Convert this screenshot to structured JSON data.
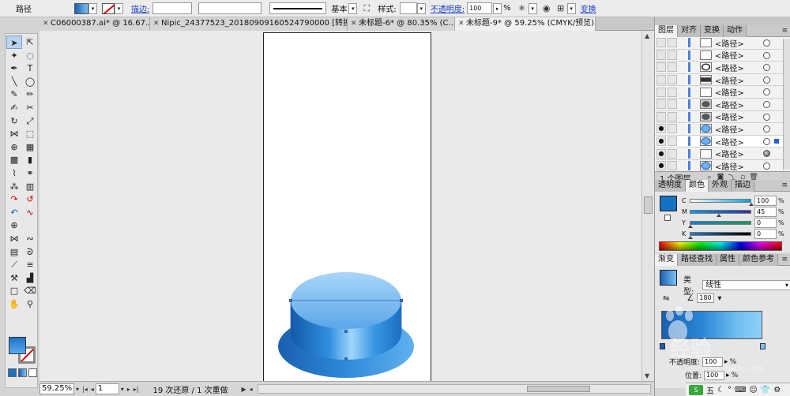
{
  "control_bar": {
    "object_label": "路径",
    "stroke_link": "描边:",
    "stroke_profile": "基本",
    "style_label": "样式:",
    "opacity_link": "不透明度:",
    "opacity_value": "100",
    "opacity_unit": "%",
    "transform_link": "变换"
  },
  "tabs": [
    {
      "label": "C06000387.ai* @ 16.67..."
    },
    {
      "label": "Nipic_24377523_20180909160524790000  [转换].ai*..."
    },
    {
      "label": "未标题-6* @ 80.35% (C..."
    },
    {
      "label": "未标题-9* @ 59.25% (CMYK/预览)"
    }
  ],
  "status_bar": {
    "zoom": "59.25%",
    "page": "1",
    "history": "19 次还原 / 1 次重做"
  },
  "layers_panel": {
    "tabs": [
      "图层",
      "对齐",
      "变换",
      "动作"
    ],
    "rows": [
      {
        "name": "<路径>",
        "visible": false,
        "thumb": "plain"
      },
      {
        "name": "<路径>",
        "visible": false,
        "thumb": "plain"
      },
      {
        "name": "<路径>",
        "visible": false,
        "thumb": "ring"
      },
      {
        "name": "<路径>",
        "visible": false,
        "thumb": "dark"
      },
      {
        "name": "<路径>",
        "visible": false,
        "thumb": "plain"
      },
      {
        "name": "<路径>",
        "visible": false,
        "thumb": "grey"
      },
      {
        "name": "<路径>",
        "visible": false,
        "thumb": "grey"
      },
      {
        "name": "<路径>",
        "visible": true,
        "thumb": "blue"
      },
      {
        "name": "<路径>",
        "visible": true,
        "thumb": "blue"
      },
      {
        "name": "<路径>",
        "visible": true,
        "thumb": "white"
      },
      {
        "name": "<路径>",
        "visible": true,
        "thumb": "blue"
      }
    ],
    "footer": "1 个图层"
  },
  "color_panel": {
    "tabs": [
      "透明度",
      "颜色",
      "外观",
      "描边"
    ],
    "channels": [
      {
        "key": "C",
        "value": "100",
        "pct": "%"
      },
      {
        "key": "M",
        "value": "45",
        "pct": "%"
      },
      {
        "key": "Y",
        "value": "0",
        "pct": "%"
      },
      {
        "key": "K",
        "value": "0",
        "pct": "%"
      }
    ]
  },
  "gradient_panel": {
    "tabs": [
      "渐变",
      "路径查找",
      "属性",
      "颜色参考"
    ],
    "type_label": "类型:",
    "type_value": "线性",
    "angle": "180",
    "opacity_label": "不透明度:",
    "opacity_value": "100",
    "position_label": "位置:",
    "position_value": "100",
    "pct": "%"
  },
  "watermark": {
    "text": "经验",
    "url": "www.baidu.com"
  },
  "taskbar": {
    "ime_label": "S",
    "ime_char": "五"
  }
}
